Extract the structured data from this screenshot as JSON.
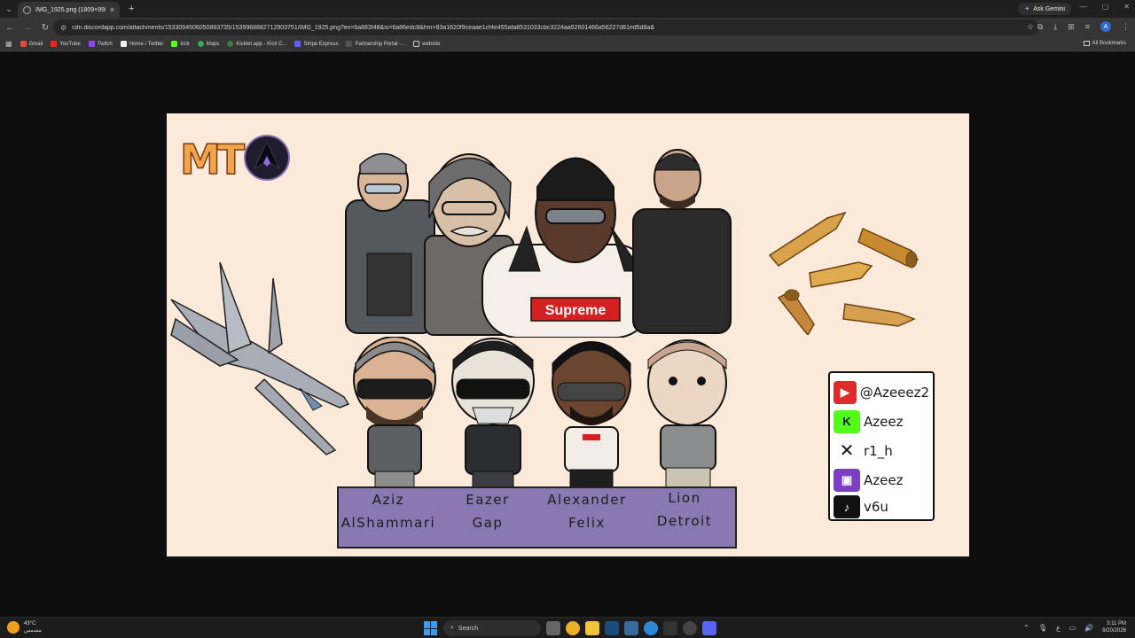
{
  "browser": {
    "tab_title": "IMG_1925.png (1809×998)",
    "ask_gemini": "Ask Gemini",
    "url": "cdn.discordapp.com/attachments/1533094506050883735/1539968882712903751/IMG_1925.png?ex=6a883f48&is=6a86edc8&hm=83a1620f9ceaae1cf4e455afa8531033cbc3224aa52601466a56227d81ed5d8a&",
    "profile_initial": "A",
    "bookmarks": [
      "Gmail",
      "YouTube",
      "Twitch",
      "Home / Twitter",
      "kick",
      "Maps",
      "Kicklet.app - Kick C...",
      "Stripe Express",
      "Partnership Portal -...",
      "website"
    ],
    "all_bookmarks": "All Bookmarks"
  },
  "image": {
    "logo_text": "MT",
    "names": [
      {
        "first": "Aziz",
        "last": "AlShammari"
      },
      {
        "first": "Eazer",
        "last": "Gap"
      },
      {
        "first": "Alexander",
        "last": "Felix"
      },
      {
        "first": "Lion",
        "last": "Detroit"
      }
    ],
    "shirt_text": "Supreme",
    "socials": [
      {
        "platform": "youtube-icon",
        "handle": "@Azeeez2",
        "color": "#e02a2a"
      },
      {
        "platform": "kick-icon",
        "handle": "Azeez",
        "color": "#53fc18"
      },
      {
        "platform": "x-icon",
        "handle": "r1_h",
        "color": "#111111"
      },
      {
        "platform": "twitch-icon",
        "handle": "Azeez",
        "color": "#7b3fc4"
      },
      {
        "platform": "tiktok-icon",
        "handle": "v6u",
        "color": "#111111"
      }
    ]
  },
  "taskbar": {
    "temperature": "43°C",
    "weather_desc": "مشمس",
    "search_placeholder": "Search",
    "time": "3:11 PM",
    "date": "8/20/2026",
    "lang": "ع"
  }
}
